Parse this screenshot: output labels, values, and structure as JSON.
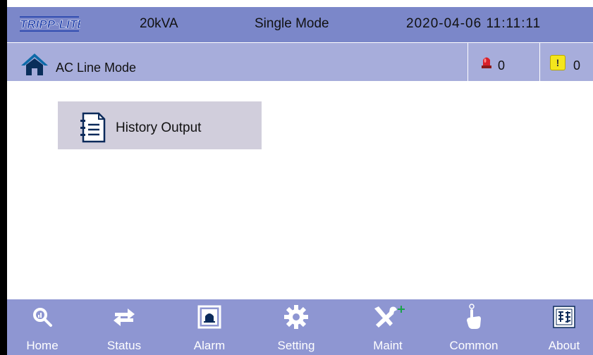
{
  "header": {
    "brand": "TRIPP·LITE",
    "capacity": "20kVA",
    "mode": "Single Mode",
    "datetime": "2020-04-06  11:11:11"
  },
  "subbar": {
    "mode_label": "AC Line Mode",
    "alarm_count": "0",
    "warning_count": "0",
    "warning_symbol": "!"
  },
  "main": {
    "menu_items": [
      {
        "label": "History Output",
        "icon": "document-list-icon"
      }
    ]
  },
  "nav": {
    "items": [
      {
        "label": "Home",
        "icon": "magnifier-chart-icon"
      },
      {
        "label": "Status",
        "icon": "swap-arrows-icon"
      },
      {
        "label": "Alarm",
        "icon": "alarm-bell-icon"
      },
      {
        "label": "Setting",
        "icon": "gear-icon"
      },
      {
        "label": "Maint",
        "icon": "tools-icon"
      },
      {
        "label": "Common",
        "icon": "hand-pointer-icon"
      },
      {
        "label": "About",
        "icon": "info-panel-icon"
      }
    ]
  },
  "colors": {
    "header_bg": "#7b87c9",
    "subbar_bg": "#a7addb",
    "nav_bg": "#8e96d2",
    "menu_btn_bg": "#d1cedc"
  }
}
